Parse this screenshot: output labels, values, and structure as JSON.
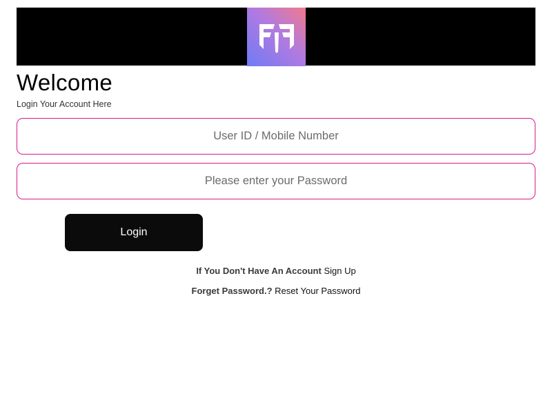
{
  "header": {
    "logo_icon": "ff-logo-icon",
    "logo_gradient": [
      "#f07a8c",
      "#b27ae0",
      "#6e7bf5"
    ],
    "background": "#000000"
  },
  "main": {
    "title": "Welcome",
    "subtitle": "Login Your Account Here"
  },
  "form": {
    "user_placeholder": "User ID / Mobile Number",
    "password_placeholder": "Please enter your Password",
    "login_label": "Login",
    "field_border_color": "#d6198c"
  },
  "footer_links": {
    "signup_prompt": "If You Don't Have An Account",
    "signup_link": "Sign Up",
    "forgot_prompt": "Forget Password.?",
    "reset_link": "Reset Your Password"
  }
}
